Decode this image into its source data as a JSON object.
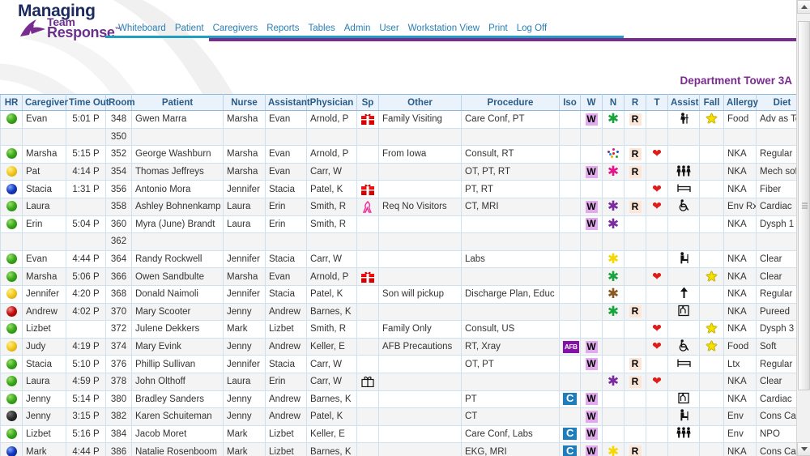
{
  "app": {
    "logo": {
      "line1": "Managing",
      "line2": "Team",
      "line3": "Response",
      "tm": "™"
    },
    "brand_colors": {
      "navy": "#1b2a5e",
      "purple": "#6b2f8c",
      "teal_rule": "#1f9ebf",
      "purple_rule": "#7a2b8f",
      "nav_link": "#2a7fb5"
    }
  },
  "nav": {
    "items": [
      {
        "label": "Whiteboard"
      },
      {
        "label": "Patient"
      },
      {
        "label": "Caregivers"
      },
      {
        "label": "Reports"
      },
      {
        "label": "Tables"
      },
      {
        "label": "Admin"
      },
      {
        "label": "User"
      },
      {
        "label": "Workstation View"
      },
      {
        "label": "Print"
      },
      {
        "label": "Log Off"
      }
    ]
  },
  "page": {
    "department_title": "Department Tower 3A"
  },
  "table": {
    "columns": [
      {
        "key": "hr",
        "label": "HR"
      },
      {
        "key": "caregiver",
        "label": "Caregiver"
      },
      {
        "key": "timeout",
        "label": "Time Out"
      },
      {
        "key": "room",
        "label": "Room"
      },
      {
        "key": "patient",
        "label": "Patient"
      },
      {
        "key": "nurse",
        "label": "Nurse"
      },
      {
        "key": "assistant",
        "label": "Assistant"
      },
      {
        "key": "physician",
        "label": "Physician"
      },
      {
        "key": "sp",
        "label": "Sp"
      },
      {
        "key": "other",
        "label": "Other"
      },
      {
        "key": "procedure",
        "label": "Procedure"
      },
      {
        "key": "iso",
        "label": "Iso"
      },
      {
        "key": "w",
        "label": "W"
      },
      {
        "key": "n",
        "label": "N"
      },
      {
        "key": "r",
        "label": "R"
      },
      {
        "key": "t",
        "label": "T"
      },
      {
        "key": "assist",
        "label": "Assist"
      },
      {
        "key": "fall",
        "label": "Fall"
      },
      {
        "key": "allergy",
        "label": "Allergy"
      },
      {
        "key": "diet",
        "label": "Diet"
      }
    ],
    "rows": [
      {
        "hr": "green",
        "caregiver": "Evan",
        "timeout": "5:01 P",
        "room": "348",
        "patient": "Gwen Marra",
        "nurse": "Marsha",
        "assistant": "Evan",
        "physician": "Arnold, P",
        "sp": "gift-red",
        "other": "Family Visiting",
        "procedure": "Care Conf, PT",
        "iso": "",
        "w": "W",
        "n": "ast-green",
        "r": "R",
        "t": "",
        "assist": "walker-person",
        "fall": "star",
        "allergy": "Food",
        "diet": "Adv as Tol"
      },
      {
        "hr": "",
        "caregiver": "",
        "timeout": "",
        "room": "350",
        "patient": "",
        "nurse": "",
        "assistant": "",
        "physician": "",
        "sp": "",
        "other": "",
        "procedure": "",
        "iso": "",
        "w": "",
        "n": "",
        "r": "",
        "t": "",
        "assist": "",
        "fall": "",
        "allergy": "",
        "diet": ""
      },
      {
        "hr": "green",
        "caregiver": "Marsha",
        "timeout": "5:15 P",
        "room": "352",
        "patient": "George Washburn",
        "nurse": "Marsha",
        "assistant": "Evan",
        "physician": "Arnold, P",
        "sp": "",
        "other": "From Iowa",
        "procedure": "Consult, RT",
        "iso": "",
        "w": "",
        "n": "ast-multi",
        "r": "R",
        "t": "heart",
        "assist": "",
        "fall": "",
        "allergy": "NKA",
        "diet": "Regular"
      },
      {
        "hr": "yellow",
        "caregiver": "Pat",
        "timeout": "4:14 P",
        "room": "354",
        "patient": "Thomas Jeffreys",
        "nurse": "Marsha",
        "assistant": "Evan",
        "physician": "Carr, W",
        "sp": "",
        "other": "",
        "procedure": "OT, PT, RT",
        "iso": "",
        "w": "W",
        "n": "ast-magenta",
        "r": "R",
        "t": "",
        "assist": "two-person-assist",
        "fall": "",
        "allergy": "NKA",
        "diet": "Mech soft"
      },
      {
        "hr": "blue",
        "caregiver": "Stacia",
        "timeout": "1:31 P",
        "room": "356",
        "patient": "Antonio Mora",
        "nurse": "Jennifer",
        "assistant": "Stacia",
        "physician": "Patel, K",
        "sp": "gift-red",
        "other": "",
        "procedure": "PT, RT",
        "iso": "",
        "w": "",
        "n": "",
        "r": "",
        "t": "heart",
        "assist": "bed",
        "fall": "",
        "allergy": "NKA",
        "diet": "Fiber"
      },
      {
        "hr": "green",
        "caregiver": "Laura",
        "timeout": "",
        "room": "358",
        "patient": "Ashley Bohnenkamp",
        "nurse": "Laura",
        "assistant": "Erin",
        "physician": "Smith, R",
        "sp": "ribbon-pink",
        "other": "Req No Visitors",
        "procedure": "CT, MRI",
        "iso": "",
        "w": "W",
        "n": "ast-purple",
        "r": "R",
        "t": "heart",
        "assist": "wheelchair",
        "fall": "",
        "allergy": "Env Rx",
        "diet": "Cardiac"
      },
      {
        "hr": "green",
        "caregiver": "Erin",
        "timeout": "5:04 P",
        "room": "360",
        "patient": "Myra (June) Brandt",
        "nurse": "Laura",
        "assistant": "Erin",
        "physician": "Smith, R",
        "sp": "",
        "other": "",
        "procedure": "",
        "iso": "",
        "w": "W",
        "n": "ast-purple",
        "r": "",
        "t": "",
        "assist": "",
        "fall": "",
        "allergy": "NKA",
        "diet": "Dysph 1"
      },
      {
        "hr": "",
        "caregiver": "",
        "timeout": "",
        "room": "362",
        "patient": "",
        "nurse": "",
        "assistant": "",
        "physician": "",
        "sp": "",
        "other": "",
        "procedure": "",
        "iso": "",
        "w": "",
        "n": "",
        "r": "",
        "t": "",
        "assist": "",
        "fall": "",
        "allergy": "",
        "diet": ""
      },
      {
        "hr": "green",
        "caregiver": "Evan",
        "timeout": "4:44 P",
        "room": "364",
        "patient": "Randy Rockwell",
        "nurse": "Jennifer",
        "assistant": "Stacia",
        "physician": "Carr, W",
        "sp": "",
        "other": "",
        "procedure": "Labs",
        "iso": "",
        "w": "",
        "n": "ast-yellow",
        "r": "",
        "t": "",
        "assist": "cane-seated",
        "fall": "",
        "allergy": "NKA",
        "diet": "Clear"
      },
      {
        "hr": "green",
        "caregiver": "Marsha",
        "timeout": "5:06 P",
        "room": "366",
        "patient": "Owen Sandbulte",
        "nurse": "Marsha",
        "assistant": "Evan",
        "physician": "Arnold, P",
        "sp": "gift-red",
        "other": "",
        "procedure": "",
        "iso": "",
        "w": "",
        "n": "ast-green",
        "r": "",
        "t": "heart",
        "assist": "",
        "fall": "star",
        "allergy": "NKA",
        "diet": "Clear"
      },
      {
        "hr": "yellow",
        "caregiver": "Jennifer",
        "timeout": "4:20 P",
        "room": "368",
        "patient": "Donald Naimoli",
        "nurse": "Jennifer",
        "assistant": "Stacia",
        "physician": "Patel, K",
        "sp": "",
        "other": "Son will pickup",
        "procedure": "Discharge Plan, Educ",
        "iso": "",
        "w": "",
        "n": "ast-brown",
        "r": "",
        "t": "",
        "assist": "up-arrow",
        "fall": "",
        "allergy": "NKA",
        "diet": "Regular"
      },
      {
        "hr": "red",
        "caregiver": "Andrew",
        "timeout": "4:02 P",
        "room": "370",
        "patient": "Mary Scooter",
        "nurse": "Jenny",
        "assistant": "Andrew",
        "physician": "Barnes, K",
        "sp": "",
        "other": "",
        "procedure": "",
        "iso": "",
        "w": "",
        "n": "ast-green",
        "r": "R",
        "t": "",
        "assist": "bed-rail",
        "fall": "",
        "allergy": "NKA",
        "diet": "Pureed"
      },
      {
        "hr": "green",
        "caregiver": "Lizbet",
        "timeout": "",
        "room": "372",
        "patient": "Julene Dekkers",
        "nurse": "Mark",
        "assistant": "Lizbet",
        "physician": "Smith, R",
        "sp": "",
        "other": "Family Only",
        "procedure": "Consult, US",
        "iso": "",
        "w": "",
        "n": "",
        "r": "",
        "t": "heart",
        "assist": "",
        "fall": "star",
        "allergy": "NKA",
        "diet": "Dysph 3"
      },
      {
        "hr": "yellow",
        "caregiver": "Judy",
        "timeout": "4:19 P",
        "room": "374",
        "patient": "Mary Evink",
        "nurse": "Jenny",
        "assistant": "Andrew",
        "physician": "Keller, E",
        "sp": "",
        "other": "AFB Precautions",
        "procedure": "RT, Xray",
        "iso": "AFB",
        "w": "W",
        "n": "",
        "r": "",
        "t": "heart",
        "assist": "wheelchair",
        "fall": "star",
        "allergy": "Food",
        "diet": "Soft"
      },
      {
        "hr": "green",
        "caregiver": "Stacia",
        "timeout": "5:10 P",
        "room": "376",
        "patient": "Phillip Sullivan",
        "nurse": "Jennifer",
        "assistant": "Stacia",
        "physician": "Carr, W",
        "sp": "",
        "other": "",
        "procedure": "OT, PT",
        "iso": "",
        "w": "W",
        "n": "",
        "r": "R",
        "t": "",
        "assist": "bed",
        "fall": "",
        "allergy": "Ltx",
        "diet": "Regular"
      },
      {
        "hr": "green",
        "caregiver": "Laura",
        "timeout": "4:59 P",
        "room": "378",
        "patient": "John Olthoff",
        "nurse": "Laura",
        "assistant": "Erin",
        "physician": "Carr, W",
        "sp": "gift-outline",
        "other": "",
        "procedure": "",
        "iso": "",
        "w": "",
        "n": "ast-purple",
        "r": "R",
        "t": "heart",
        "assist": "",
        "fall": "",
        "allergy": "NKA",
        "diet": "Clear"
      },
      {
        "hr": "green",
        "caregiver": "Jenny",
        "timeout": "5:14 P",
        "room": "380",
        "patient": "Bradley Sanders",
        "nurse": "Jenny",
        "assistant": "Andrew",
        "physician": "Barnes, K",
        "sp": "",
        "other": "",
        "procedure": "PT",
        "iso": "C",
        "w": "W",
        "n": "",
        "r": "",
        "t": "",
        "assist": "bed-rail",
        "fall": "",
        "allergy": "NKA",
        "diet": "Cardiac"
      },
      {
        "hr": "black",
        "caregiver": "Jenny",
        "timeout": "3:15 P",
        "room": "382",
        "patient": "Karen Schuiteman",
        "nurse": "Jenny",
        "assistant": "Andrew",
        "physician": "Patel, K",
        "sp": "",
        "other": "",
        "procedure": "CT",
        "iso": "",
        "w": "W",
        "n": "",
        "r": "",
        "t": "",
        "assist": "cane-seated",
        "fall": "",
        "allergy": "Env",
        "diet": "Cons Carb"
      },
      {
        "hr": "green",
        "caregiver": "Lizbet",
        "timeout": "5:16 P",
        "room": "384",
        "patient": "Jacob Moret",
        "nurse": "Mark",
        "assistant": "Lizbet",
        "physician": "Keller, E",
        "sp": "",
        "other": "",
        "procedure": "Care Conf, Labs",
        "iso": "C",
        "w": "W",
        "n": "",
        "r": "",
        "t": "",
        "assist": "two-person-assist",
        "fall": "",
        "allergy": "Env",
        "diet": "NPO"
      },
      {
        "hr": "blue",
        "caregiver": "Mark",
        "timeout": "4:44 P",
        "room": "386",
        "patient": "Natalie Rosenboom",
        "nurse": "Mark",
        "assistant": "Lizbet",
        "physician": "Barnes, K",
        "sp": "",
        "other": "",
        "procedure": "EKG, MRI",
        "iso": "C",
        "w": "W",
        "n": "ast-yellow",
        "r": "R",
        "t": "",
        "assist": "",
        "fall": "",
        "allergy": "NKA",
        "diet": "Cons Carb"
      }
    ]
  },
  "scrollbar": {
    "up_label": "▲",
    "down_label": "▼"
  }
}
